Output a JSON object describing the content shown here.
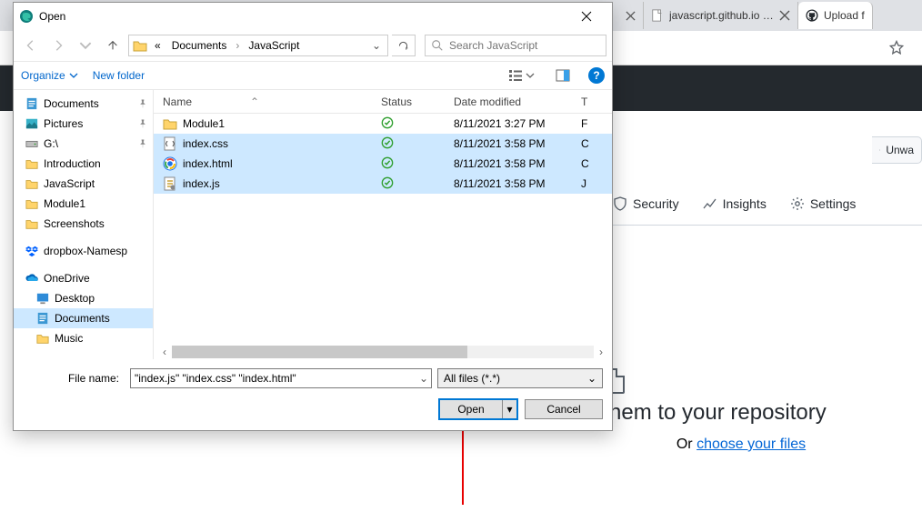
{
  "browser": {
    "tabs": [
      {
        "title": "javascript.github.io | Learn Ja"
      },
      {
        "title": "Upload f"
      }
    ],
    "star_tooltip": "Favorites"
  },
  "github": {
    "unwatch": "Unwa",
    "tabs": {
      "security": "Security",
      "insights": "Insights",
      "settings": "Settings"
    },
    "drop": {
      "title_suffix": "hem to your repository",
      "or": "Or ",
      "choose": "choose your files"
    }
  },
  "dialog": {
    "title": "Open",
    "nav": {
      "breadcrumb_prefix": "«",
      "crumbs": [
        "Documents",
        "JavaScript"
      ]
    },
    "search_placeholder": "Search JavaScript",
    "toolbar": {
      "organize": "Organize",
      "new_folder": "New folder"
    },
    "columns": {
      "name": "Name",
      "status": "Status",
      "date": "Date modified",
      "type": "T"
    },
    "tree": {
      "quick": [
        {
          "label": "Documents",
          "icon": "doc",
          "pinned": true
        },
        {
          "label": "Pictures",
          "icon": "pictures",
          "pinned": true
        },
        {
          "label": "G:\\",
          "icon": "drive",
          "pinned": true
        },
        {
          "label": "Introduction",
          "icon": "folder"
        },
        {
          "label": "JavaScript",
          "icon": "folder"
        },
        {
          "label": "Module1",
          "icon": "folder"
        },
        {
          "label": "Screenshots",
          "icon": "folder"
        }
      ],
      "dropbox": "dropbox-Namesp",
      "onedrive": "OneDrive",
      "onedrive_children": [
        {
          "label": "Desktop",
          "icon": "desktop"
        },
        {
          "label": "Documents",
          "icon": "doc",
          "selected": true
        },
        {
          "label": "Music",
          "icon": "folder"
        }
      ]
    },
    "files": [
      {
        "name": "Module1",
        "icon": "folder",
        "status": "synced",
        "date": "8/11/2021 3:27 PM",
        "type": "F",
        "selected": false
      },
      {
        "name": "index.css",
        "icon": "css",
        "status": "synced",
        "date": "8/11/2021 3:58 PM",
        "type": "C",
        "selected": true
      },
      {
        "name": "index.html",
        "icon": "html",
        "status": "synced",
        "date": "8/11/2021 3:58 PM",
        "type": "C",
        "selected": true
      },
      {
        "name": "index.js",
        "icon": "js",
        "status": "synced",
        "date": "8/11/2021 3:58 PM",
        "type": "J",
        "selected": true
      }
    ],
    "footer": {
      "file_name_label": "File name:",
      "file_name_value": "\"index.js\" \"index.css\" \"index.html\"",
      "filter": "All files (*.*)",
      "open": "Open",
      "cancel": "Cancel"
    }
  },
  "colors": {
    "selection": "#cde8ff",
    "link": "#0066cc",
    "accent": "#0078d4",
    "danger": "#e80000"
  }
}
